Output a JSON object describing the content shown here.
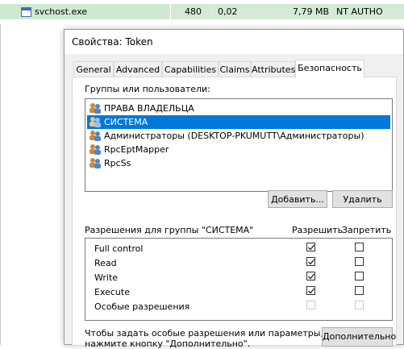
{
  "process_row": {
    "name": "svchost.exe",
    "pid": "480",
    "cpu": "0,02",
    "memory": "7,79 MB",
    "user": "NT AUTHO"
  },
  "dialog": {
    "title": "Свойства: Token",
    "tabs": [
      "General",
      "Advanced",
      "Capabilities",
      "Claims",
      "Attributes",
      "Безопасность"
    ],
    "active_tab": "Безопасность",
    "groups_label": "Группы или пользователи:",
    "groups": [
      {
        "name": "ПРАВА ВЛАДЕЛЬЦА",
        "selected": false
      },
      {
        "name": "СИСТЕМА",
        "selected": true
      },
      {
        "name": "Администраторы (DESKTOP-PKUMUTT\\Администраторы)",
        "selected": false
      },
      {
        "name": "RpcEptMapper",
        "selected": false
      },
      {
        "name": "RpcSs",
        "selected": false
      }
    ],
    "add_button": "Добавить...",
    "remove_button": "Удалить",
    "permissions_label": "Разрешения для группы \"СИСТЕМА\"",
    "allow_header": "Разрешить",
    "deny_header": "Запретить",
    "permissions": [
      {
        "name": "Full control",
        "allow": true,
        "deny": false
      },
      {
        "name": "Read",
        "allow": true,
        "deny": false
      },
      {
        "name": "Write",
        "allow": true,
        "deny": false
      },
      {
        "name": "Execute",
        "allow": true,
        "deny": false
      },
      {
        "name": "Особые разрешения",
        "allow": false,
        "deny": false,
        "disabled": true
      }
    ],
    "footer_text_1": "Чтобы задать особые разрешения или параметры,",
    "footer_text_2": "нажмите кнопку \"Дополнительно\".",
    "advanced_button": "Дополнительно"
  },
  "colors": {
    "selection": "#0078d7",
    "row_highlight": "#cfe9d0"
  }
}
